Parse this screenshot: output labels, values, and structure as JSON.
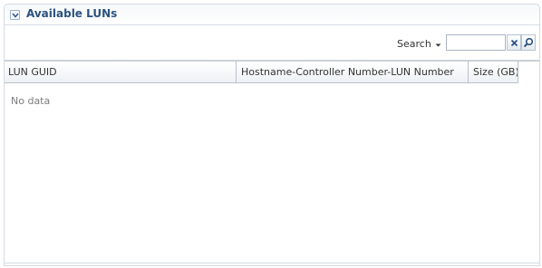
{
  "panel": {
    "title": "Available LUNs"
  },
  "toolbar": {
    "search_label": "Search",
    "search_value": "",
    "search_placeholder": ""
  },
  "table": {
    "columns": [
      {
        "label": "LUN GUID"
      },
      {
        "label": "Hostname-Controller Number-LUN Number"
      },
      {
        "label": "Size (GB)"
      }
    ],
    "empty_text": "No data"
  },
  "colors": {
    "title": "#2b5280",
    "empty_text": "#7d7d7d",
    "border": "#b9c1ca"
  },
  "icons": {
    "disclosure": "chevron-down-icon",
    "dropdown": "caret-down-icon",
    "clear": "close-icon",
    "find": "search-icon"
  }
}
